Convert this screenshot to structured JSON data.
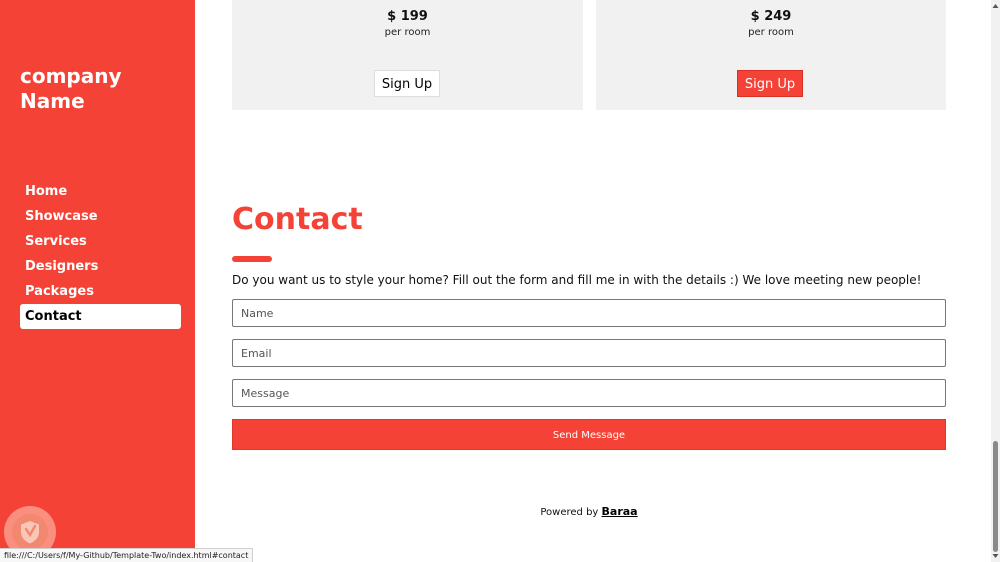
{
  "sidebar": {
    "brand": "company Name",
    "nav": [
      {
        "label": "Home"
      },
      {
        "label": "Showcase"
      },
      {
        "label": "Services"
      },
      {
        "label": "Designers"
      },
      {
        "label": "Packages"
      },
      {
        "label": "Contact",
        "active": true
      }
    ]
  },
  "pricing": {
    "plans": [
      {
        "price": "$ 199",
        "per": "per room",
        "button": "Sign Up"
      },
      {
        "price": "$ 249",
        "per": "per room",
        "button": "Sign Up"
      }
    ]
  },
  "contact": {
    "title": "Contact",
    "description": "Do you want us to style your home? Fill out the form and fill me in with the details :) We love meeting new people!",
    "fields": {
      "name_placeholder": "Name",
      "email_placeholder": "Email",
      "message_placeholder": "Message"
    },
    "submit_label": "Send Message"
  },
  "footer": {
    "prefix": "Powered by",
    "author": "Baraa"
  },
  "browser": {
    "status_url": "file:///C:/Users/f/My-Github/Template-Two/index.html#contact"
  },
  "colors": {
    "accent": "#f44336",
    "card_bg": "#f1f1f1"
  },
  "icons": {
    "floating_badge": "shield-icon",
    "scroll_up": "triangle-up-icon",
    "scroll_down": "triangle-down-icon"
  }
}
